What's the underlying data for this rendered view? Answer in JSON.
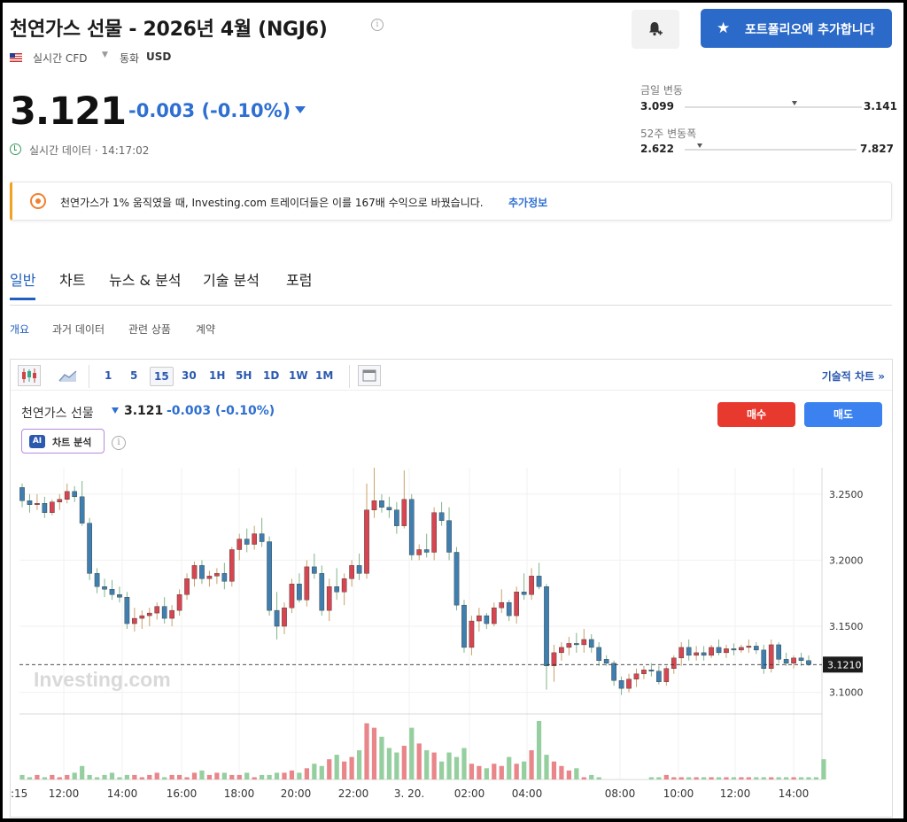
{
  "header": {
    "title": "천연가스 선물 - 2026년 4월 (NGJ6)",
    "info_symbol": "i",
    "add_portfolio_label": "포트폴리오에 추가합니다",
    "realtime_cfd": "실시간 CFD",
    "currency_label": "통화",
    "currency": "USD"
  },
  "quote": {
    "price": "3.121",
    "change": "-0.003 (-0.10%)",
    "realtime_label": "실시간 데이터 · 14:17:02",
    "day_range": {
      "label": "금일 변동",
      "low": "3.099",
      "high": "3.141",
      "position": 0.62
    },
    "week52_range": {
      "label": "52주 변동폭",
      "low": "2.622",
      "high": "7.827",
      "position": 0.09
    }
  },
  "banner": {
    "text": "천연가스가 1% 움직였을 때, Investing.com 트레이더들은 이를 167배 수익으로 바꿨습니다.",
    "link": "추가정보"
  },
  "tabs": [
    "일반",
    "차트",
    "뉴스 & 분석",
    "기술 분석",
    "포럼"
  ],
  "subtabs": [
    "개요",
    "과거 데이터",
    "관련 상품",
    "계약"
  ],
  "toolbar": {
    "intervals": [
      "1",
      "5",
      "15",
      "30",
      "1H",
      "5H",
      "1D",
      "1W",
      "1M"
    ],
    "active_interval": "15",
    "tech_chart_link": "기술적 차트 »"
  },
  "chart_header": {
    "name": "천연가스 선물",
    "price": "3.121",
    "change": "-0.003 (-0.10%)",
    "buy_label": "매수",
    "sell_label": "매도",
    "ai_badge": "AI",
    "ai_label": "차트 분석",
    "watermark": "Investing.com"
  },
  "colors": {
    "up": "#d64550",
    "down": "#3f7fb0",
    "accent": "#2b6ac8",
    "negative_text": "#2e6fd1",
    "buy": "#e8392e",
    "sell": "#3b82f0",
    "volume_up": "#e8868a",
    "volume_down": "#96cf9f"
  },
  "chart_data": {
    "type": "candlestick",
    "x_tick_labels": [
      ":15",
      "12:00",
      "14:00",
      "16:00",
      "18:00",
      "20:00",
      "22:00",
      "3. 20.",
      "02:00",
      "04:00",
      "08:00",
      "10:00",
      "12:00",
      "14:00"
    ],
    "y_ticks": [
      3.25,
      3.2,
      3.15,
      3.1
    ],
    "y_tick_labels": [
      "3.2500",
      "3.2000",
      "3.1500",
      "3.1000"
    ],
    "last_price_label": "3.1210",
    "last_price": 3.121,
    "ylim": [
      3.085,
      3.27
    ],
    "candles": [
      [
        3.255,
        3.258,
        3.24,
        3.245
      ],
      [
        3.245,
        3.25,
        3.236,
        3.242
      ],
      [
        3.242,
        3.25,
        3.238,
        3.243
      ],
      [
        3.243,
        3.248,
        3.232,
        3.236
      ],
      [
        3.236,
        3.246,
        3.234,
        3.244
      ],
      [
        3.244,
        3.25,
        3.238,
        3.246
      ],
      [
        3.246,
        3.258,
        3.243,
        3.252
      ],
      [
        3.252,
        3.256,
        3.244,
        3.248
      ],
      [
        3.248,
        3.26,
        3.226,
        3.228
      ],
      [
        3.228,
        3.232,
        3.185,
        3.19
      ],
      [
        3.19,
        3.194,
        3.175,
        3.18
      ],
      [
        3.18,
        3.186,
        3.172,
        3.178
      ],
      [
        3.178,
        3.185,
        3.17,
        3.174
      ],
      [
        3.174,
        3.18,
        3.168,
        3.172
      ],
      [
        3.172,
        3.176,
        3.148,
        3.152
      ],
      [
        3.152,
        3.164,
        3.146,
        3.156
      ],
      [
        3.156,
        3.162,
        3.148,
        3.158
      ],
      [
        3.158,
        3.164,
        3.15,
        3.16
      ],
      [
        3.16,
        3.168,
        3.155,
        3.165
      ],
      [
        3.165,
        3.172,
        3.152,
        3.156
      ],
      [
        3.156,
        3.166,
        3.15,
        3.162
      ],
      [
        3.162,
        3.178,
        3.158,
        3.174
      ],
      [
        3.174,
        3.19,
        3.17,
        3.186
      ],
      [
        3.186,
        3.199,
        3.18,
        3.196
      ],
      [
        3.196,
        3.2,
        3.182,
        3.186
      ],
      [
        3.186,
        3.192,
        3.18,
        3.188
      ],
      [
        3.188,
        3.194,
        3.182,
        3.19
      ],
      [
        3.19,
        3.198,
        3.178,
        3.184
      ],
      [
        3.184,
        3.21,
        3.18,
        3.208
      ],
      [
        3.208,
        3.22,
        3.2,
        3.216
      ],
      [
        3.216,
        3.224,
        3.206,
        3.212
      ],
      [
        3.212,
        3.226,
        3.208,
        3.22
      ],
      [
        3.22,
        3.232,
        3.21,
        3.214
      ],
      [
        3.214,
        3.218,
        3.158,
        3.162
      ],
      [
        3.162,
        3.176,
        3.14,
        3.15
      ],
      [
        3.15,
        3.168,
        3.144,
        3.164
      ],
      [
        3.164,
        3.186,
        3.16,
        3.182
      ],
      [
        3.182,
        3.19,
        3.168,
        3.17
      ],
      [
        3.17,
        3.2,
        3.165,
        3.195
      ],
      [
        3.195,
        3.205,
        3.186,
        3.19
      ],
      [
        3.19,
        3.196,
        3.158,
        3.162
      ],
      [
        3.162,
        3.186,
        3.154,
        3.18
      ],
      [
        3.18,
        3.194,
        3.17,
        3.176
      ],
      [
        3.176,
        3.19,
        3.166,
        3.186
      ],
      [
        3.186,
        3.2,
        3.18,
        3.196
      ],
      [
        3.196,
        3.205,
        3.185,
        3.19
      ],
      [
        3.19,
        3.258,
        3.186,
        3.238
      ],
      [
        3.238,
        3.27,
        3.232,
        3.245
      ],
      [
        3.245,
        3.25,
        3.236,
        3.24
      ],
      [
        3.24,
        3.248,
        3.232,
        3.238
      ],
      [
        3.238,
        3.244,
        3.22,
        3.226
      ],
      [
        3.226,
        3.268,
        3.224,
        3.246
      ],
      [
        3.246,
        3.25,
        3.2,
        3.204
      ],
      [
        3.204,
        3.212,
        3.2,
        3.208
      ],
      [
        3.208,
        3.22,
        3.202,
        3.206
      ],
      [
        3.206,
        3.24,
        3.2,
        3.236
      ],
      [
        3.236,
        3.244,
        3.226,
        3.23
      ],
      [
        3.23,
        3.24,
        3.2,
        3.206
      ],
      [
        3.206,
        3.21,
        3.162,
        3.166
      ],
      [
        3.166,
        3.17,
        3.13,
        3.134
      ],
      [
        3.134,
        3.158,
        3.128,
        3.154
      ],
      [
        3.154,
        3.164,
        3.146,
        3.158
      ],
      [
        3.158,
        3.16,
        3.148,
        3.152
      ],
      [
        3.152,
        3.168,
        3.15,
        3.164
      ],
      [
        3.164,
        3.178,
        3.16,
        3.168
      ],
      [
        3.168,
        3.17,
        3.154,
        3.158
      ],
      [
        3.158,
        3.18,
        3.152,
        3.176
      ],
      [
        3.176,
        3.19,
        3.17,
        3.174
      ],
      [
        3.174,
        3.194,
        3.17,
        3.188
      ],
      [
        3.188,
        3.198,
        3.178,
        3.18
      ],
      [
        3.18,
        3.182,
        3.102,
        3.12
      ],
      [
        3.12,
        3.136,
        3.108,
        3.13
      ],
      [
        3.13,
        3.138,
        3.124,
        3.134
      ],
      [
        3.134,
        3.142,
        3.128,
        3.137
      ],
      [
        3.137,
        3.145,
        3.13,
        3.136
      ],
      [
        3.136,
        3.148,
        3.13,
        3.14
      ],
      [
        3.14,
        3.144,
        3.13,
        3.134
      ],
      [
        3.134,
        3.138,
        3.12,
        3.124
      ],
      [
        3.125,
        3.128,
        3.12,
        3.122
      ],
      [
        3.122,
        3.124,
        3.105,
        3.109
      ],
      [
        3.109,
        3.112,
        3.098,
        3.103
      ],
      [
        3.103,
        3.114,
        3.1,
        3.11
      ],
      [
        3.11,
        3.118,
        3.104,
        3.114
      ],
      [
        3.114,
        3.12,
        3.11,
        3.117
      ],
      [
        3.117,
        3.122,
        3.112,
        3.116
      ],
      [
        3.116,
        3.12,
        3.106,
        3.108
      ],
      [
        3.108,
        3.12,
        3.105,
        3.118
      ],
      [
        3.118,
        3.128,
        3.114,
        3.126
      ],
      [
        3.126,
        3.138,
        3.12,
        3.134
      ],
      [
        3.134,
        3.14,
        3.124,
        3.128
      ],
      [
        3.128,
        3.135,
        3.124,
        3.13
      ],
      [
        3.13,
        3.135,
        3.124,
        3.128
      ],
      [
        3.128,
        3.136,
        3.126,
        3.134
      ],
      [
        3.134,
        3.14,
        3.128,
        3.13
      ],
      [
        3.13,
        3.136,
        3.126,
        3.133
      ],
      [
        3.133,
        3.137,
        3.128,
        3.132
      ],
      [
        3.132,
        3.136,
        3.13,
        3.134
      ],
      [
        3.134,
        3.14,
        3.13,
        3.135
      ],
      [
        3.135,
        3.138,
        3.129,
        3.132
      ],
      [
        3.132,
        3.136,
        3.114,
        3.118
      ],
      [
        3.118,
        3.14,
        3.115,
        3.136
      ],
      [
        3.136,
        3.138,
        3.122,
        3.125
      ],
      [
        3.125,
        3.13,
        3.12,
        3.122
      ],
      [
        3.122,
        3.128,
        3.118,
        3.126
      ],
      [
        3.126,
        3.13,
        3.12,
        3.124
      ],
      [
        3.124,
        3.128,
        3.12,
        3.121
      ]
    ],
    "volume": [
      2,
      1,
      2,
      1,
      2,
      1,
      2,
      3,
      6,
      2,
      1,
      2,
      3,
      1,
      2,
      2,
      1,
      2,
      3,
      1,
      2,
      2,
      1,
      3,
      4,
      2,
      3,
      3,
      2,
      2,
      3,
      1,
      2,
      2,
      3,
      3,
      4,
      3,
      5,
      7,
      6,
      9,
      11,
      8,
      10,
      13,
      25,
      23,
      19,
      14,
      12,
      15,
      23,
      16,
      13,
      12,
      8,
      12,
      10,
      14,
      7,
      6,
      5,
      7,
      6,
      10,
      7,
      8,
      13,
      26,
      11,
      8,
      6,
      4,
      5,
      1,
      2,
      1,
      0,
      0,
      0,
      0,
      0,
      0,
      1,
      1,
      2,
      1,
      1,
      1,
      1,
      1,
      1,
      1,
      1,
      1,
      1,
      1,
      1,
      1,
      1,
      1,
      1,
      1,
      1,
      1,
      1,
      9
    ]
  }
}
